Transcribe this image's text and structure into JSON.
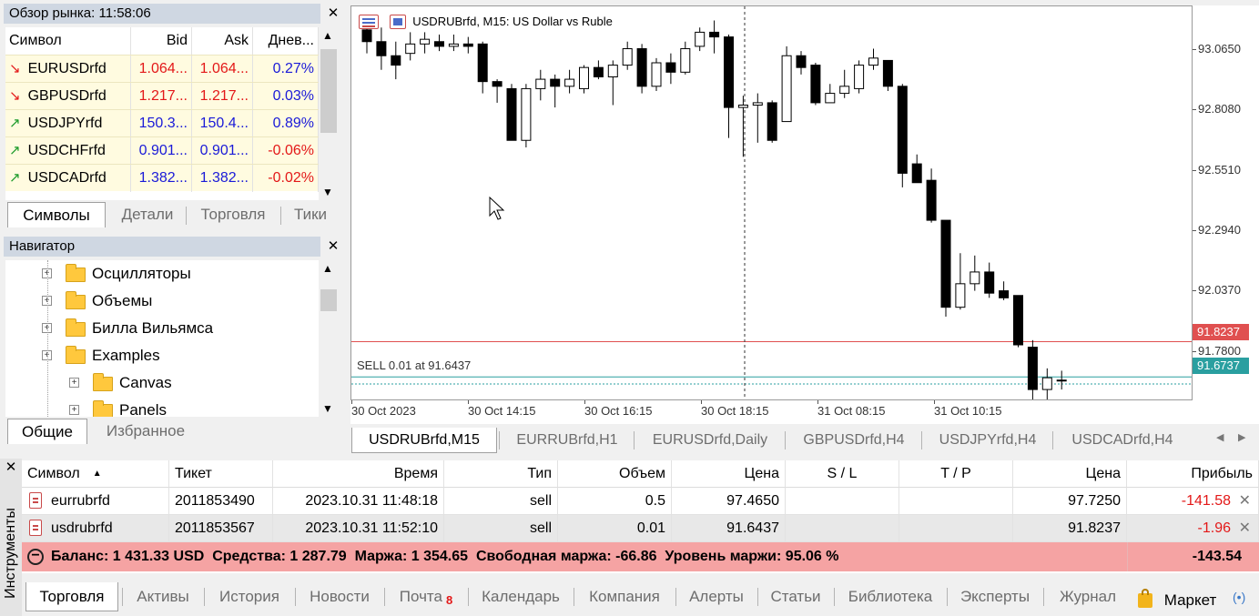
{
  "market_watch": {
    "title": "Обзор рынка: 11:58:06",
    "columns": [
      "Символ",
      "Bid",
      "Ask",
      "Днев..."
    ],
    "rows": [
      {
        "symbol": "EURUSDrfd",
        "bid": "1.064...",
        "ask": "1.064...",
        "change": "0.27%",
        "dir": "down",
        "price_color": "#e31818",
        "change_color": "#1a1ad8"
      },
      {
        "symbol": "GBPUSDrfd",
        "bid": "1.217...",
        "ask": "1.217...",
        "change": "0.03%",
        "dir": "down",
        "price_color": "#e31818",
        "change_color": "#1a1ad8"
      },
      {
        "symbol": "USDJPYrfd",
        "bid": "150.3...",
        "ask": "150.4...",
        "change": "0.89%",
        "dir": "up",
        "price_color": "#1a1ad8",
        "change_color": "#1a1ad8"
      },
      {
        "symbol": "USDCHFrfd",
        "bid": "0.901...",
        "ask": "0.901...",
        "change": "-0.06%",
        "dir": "up",
        "price_color": "#1a1ad8",
        "change_color": "#e31818"
      },
      {
        "symbol": "USDCADrfd",
        "bid": "1.382...",
        "ask": "1.382...",
        "change": "-0.02%",
        "dir": "up",
        "price_color": "#1a1ad8",
        "change_color": "#e31818"
      }
    ],
    "tabs": [
      "Символы",
      "Детали",
      "Торговля",
      "Тики"
    ]
  },
  "navigator": {
    "title": "Навигатор",
    "items": [
      {
        "label": "Осцилляторы",
        "indent": 0
      },
      {
        "label": "Объемы",
        "indent": 0
      },
      {
        "label": "Билла Вильямса",
        "indent": 0
      },
      {
        "label": "Examples",
        "indent": 0
      },
      {
        "label": "Canvas",
        "indent": 1
      },
      {
        "label": "Panels",
        "indent": 1
      }
    ],
    "tabs": [
      "Общие",
      "Избранное"
    ]
  },
  "chart": {
    "symbol_title": "USDRUBrfd, M15:  US Dollar vs Ruble",
    "sell_label": "SELL 0.01 at 91.6437",
    "bid_line_label": "91.8237",
    "sell_line_label": "91.6737",
    "bid_color": "#e05050",
    "sell_color": "#2a9fa0"
  },
  "chart_data": {
    "type": "candlestick",
    "price_ticks": [
      "93.0650",
      "92.8080",
      "92.5510",
      "92.2940",
      "92.0370",
      "91.7800"
    ],
    "time_ticks": [
      "30 Oct 2023",
      "30 Oct 14:15",
      "30 Oct 16:15",
      "30 Oct 18:15",
      "31 Oct 08:15",
      "31 Oct 10:15"
    ],
    "ylim": [
      91.57,
      93.25
    ],
    "candles": [
      [
        93.15,
        93.1,
        93.19,
        93.05
      ],
      [
        93.1,
        93.04,
        93.16,
        92.98
      ],
      [
        93.04,
        93.0,
        93.1,
        92.94
      ],
      [
        93.05,
        93.09,
        93.14,
        93.02
      ],
      [
        93.09,
        93.11,
        93.14,
        93.05
      ],
      [
        93.1,
        93.08,
        93.13,
        93.06
      ],
      [
        93.08,
        93.09,
        93.13,
        93.06
      ],
      [
        93.09,
        93.08,
        93.12,
        93.05
      ],
      [
        93.09,
        92.93,
        93.1,
        92.88
      ],
      [
        92.93,
        92.91,
        92.94,
        92.84
      ],
      [
        92.9,
        92.68,
        92.92,
        92.68
      ],
      [
        92.68,
        92.9,
        92.92,
        92.65
      ],
      [
        92.9,
        92.94,
        92.98,
        92.85
      ],
      [
        92.94,
        92.91,
        92.96,
        92.82
      ],
      [
        92.91,
        92.94,
        92.98,
        92.88
      ],
      [
        92.9,
        92.99,
        93.0,
        92.88
      ],
      [
        92.99,
        92.95,
        93.02,
        92.94
      ],
      [
        92.95,
        93.0,
        93.02,
        92.83
      ],
      [
        93.0,
        93.07,
        93.1,
        92.98
      ],
      [
        93.07,
        92.91,
        93.09,
        92.88
      ],
      [
        92.91,
        93.01,
        93.03,
        92.89
      ],
      [
        93.01,
        92.97,
        93.05,
        92.92
      ],
      [
        92.97,
        93.07,
        93.1,
        92.96
      ],
      [
        93.08,
        93.14,
        93.16,
        93.06
      ],
      [
        93.14,
        93.12,
        93.19,
        93.05
      ],
      [
        93.12,
        92.82,
        93.13,
        92.69
      ],
      [
        92.82,
        92.83,
        92.87,
        92.61
      ],
      [
        92.83,
        92.84,
        92.88,
        92.67
      ],
      [
        92.84,
        92.68,
        92.85,
        92.67
      ],
      [
        92.76,
        93.04,
        93.08,
        92.76
      ],
      [
        93.04,
        92.99,
        93.06,
        92.96
      ],
      [
        93.0,
        92.84,
        93.01,
        92.83
      ],
      [
        92.84,
        92.88,
        92.92,
        92.84
      ],
      [
        92.88,
        92.91,
        92.98,
        92.86
      ],
      [
        92.9,
        93.0,
        93.02,
        92.88
      ],
      [
        93.0,
        93.03,
        93.07,
        92.98
      ],
      [
        93.02,
        92.91,
        93.02,
        92.89
      ],
      [
        92.91,
        92.54,
        92.92,
        92.48
      ],
      [
        92.58,
        92.5,
        92.62,
        92.5
      ],
      [
        92.51,
        92.34,
        92.56,
        92.33
      ],
      [
        92.34,
        91.97,
        92.34,
        91.93
      ],
      [
        91.97,
        92.07,
        92.2,
        91.96
      ],
      [
        92.07,
        92.12,
        92.19,
        92.04
      ],
      [
        92.12,
        92.03,
        92.16,
        92.01
      ],
      [
        92.04,
        92.01,
        92.08,
        92.0
      ],
      [
        92.02,
        91.81,
        92.02,
        91.8
      ],
      [
        91.8,
        91.62,
        91.83,
        91.56
      ],
      [
        91.62,
        91.67,
        91.71,
        91.56
      ],
      [
        91.66,
        91.66,
        91.7,
        91.62
      ]
    ]
  },
  "chart_tabs": [
    "USDRUBrfd,M15",
    "EURRUBrfd,H1",
    "EURUSDrfd,Daily",
    "GBPUSDrfd,H4",
    "USDJPYrfd,H4",
    "USDCADrfd,H4"
  ],
  "toolbox": {
    "side_label": "Инструменты",
    "columns": [
      "Символ",
      "Тикет",
      "Время",
      "Тип",
      "Объем",
      "Цена",
      "S / L",
      "T / P",
      "Цена",
      "Прибыль"
    ],
    "rows": [
      {
        "symbol": "eurrubrfd",
        "ticket": "2011853490",
        "time": "2023.10.31 11:48:18",
        "type": "sell",
        "volume": "0.5",
        "price": "97.4650",
        "sl": "",
        "tp": "",
        "current": "97.7250",
        "profit": "-141.58"
      },
      {
        "symbol": "usdrubrfd",
        "ticket": "2011853567",
        "time": "2023.10.31 11:52:10",
        "type": "sell",
        "volume": "0.01",
        "price": "91.6437",
        "sl": "",
        "tp": "",
        "current": "91.8237",
        "profit": "-1.96"
      }
    ],
    "summary": "Баланс: 1 431.33 USD  Средства: 1 287.79  Маржа: 1 354.65  Свободная маржа: -66.86  Уровень маржи: 95.06 %",
    "summary_profit": "-143.54",
    "tabs": [
      "Торговля",
      "Активы",
      "История",
      "Новости",
      "Почта",
      "Календарь",
      "Компания",
      "Алерты",
      "Статьи",
      "Библиотека",
      "Эксперты",
      "Журнал"
    ],
    "mail_badge": "8",
    "market_label": "Маркет"
  }
}
